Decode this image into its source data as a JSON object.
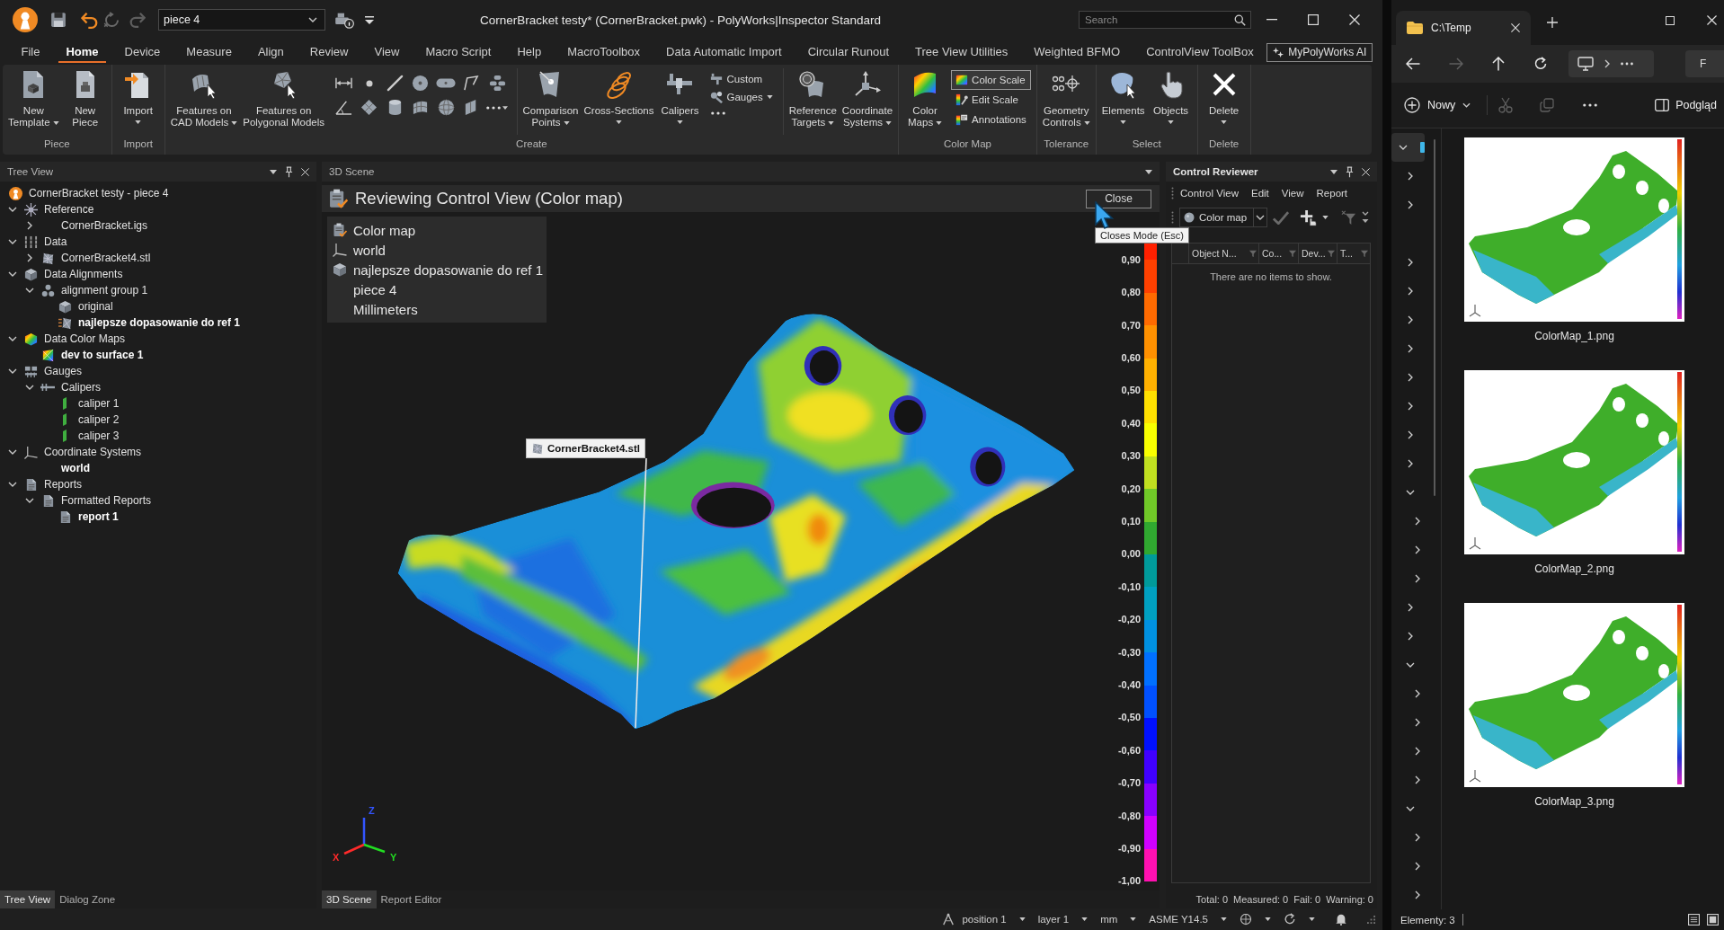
{
  "window": {
    "title": "CornerBracket testy* (CornerBracket.pwk) - PolyWorks|Inspector Standard",
    "piece": "piece 4",
    "search_placeholder": "Search"
  },
  "menu_tabs": [
    {
      "label": "File",
      "selected": false
    },
    {
      "label": "Home",
      "selected": true
    },
    {
      "label": "Device",
      "selected": false
    },
    {
      "label": "Measure",
      "selected": false
    },
    {
      "label": "Align",
      "selected": false
    },
    {
      "label": "Review",
      "selected": false
    },
    {
      "label": "View",
      "selected": false
    },
    {
      "label": "Macro Script",
      "selected": false
    },
    {
      "label": "Help",
      "selected": false
    },
    {
      "label": "MacroToolbox",
      "selected": false
    },
    {
      "label": "Data Automatic Import",
      "selected": false
    },
    {
      "label": "Circular Runout",
      "selected": false
    },
    {
      "label": "Tree View Utilities",
      "selected": false
    },
    {
      "label": "Weighted BFMO",
      "selected": false
    },
    {
      "label": "ControlView ToolBox",
      "selected": false
    }
  ],
  "ai_button": "MyPolyWorks AI",
  "ribbon": [
    {
      "label": "Piece",
      "items": [
        {
          "kind": "large",
          "label": "New\nTemplate",
          "dropdown": true
        },
        {
          "kind": "large",
          "label": "New\nPiece",
          "dropdown": false
        }
      ]
    },
    {
      "label": "Import",
      "items": [
        {
          "kind": "large",
          "label": "Import",
          "dropdown": true
        }
      ]
    },
    {
      "label": "Create",
      "items": [
        {
          "kind": "large",
          "label": "Features on\nCAD Models",
          "dropdown": true
        },
        {
          "kind": "large",
          "label": "Features on\nPolygonal Models",
          "dropdown": false
        },
        {
          "kind": "tools"
        },
        {
          "kind": "separator"
        },
        {
          "kind": "large",
          "label": "Comparison\nPoints",
          "dropdown": true
        },
        {
          "kind": "large",
          "label": "Cross-Sections",
          "dropdown": true
        },
        {
          "kind": "large",
          "label": "Calipers",
          "dropdown": true
        },
        {
          "kind": "stack",
          "items": [
            {
              "kind": "button",
              "label": "Custom",
              "dropdown": false,
              "on": false
            },
            {
              "kind": "button",
              "label": "Gauges",
              "dropdown": true,
              "on": false
            },
            {
              "kind": "more"
            }
          ]
        },
        {
          "kind": "separator"
        },
        {
          "kind": "large",
          "label": "Reference\nTargets",
          "dropdown": true
        },
        {
          "kind": "large",
          "label": "Coordinate\nSystems",
          "dropdown": true
        }
      ]
    },
    {
      "label": "Color Map",
      "items": [
        {
          "kind": "large",
          "label": "Color\nMaps",
          "dropdown": true
        },
        {
          "kind": "stack",
          "items": [
            {
              "kind": "button",
              "label": "Color Scale",
              "dropdown": false,
              "on": true
            },
            {
              "kind": "button",
              "label": "Edit Scale",
              "dropdown": false,
              "on": false
            },
            {
              "kind": "button",
              "label": "Annotations",
              "dropdown": false,
              "on": false
            }
          ]
        }
      ]
    },
    {
      "label": "Tolerance",
      "items": [
        {
          "kind": "large",
          "label": "Geometry\nControls",
          "dropdown": true
        }
      ]
    },
    {
      "label": "Select",
      "items": [
        {
          "kind": "large",
          "label": "Elements",
          "dropdown": true
        },
        {
          "kind": "large",
          "label": "Objects",
          "dropdown": true
        }
      ]
    },
    {
      "label": "Delete",
      "items": [
        {
          "kind": "large",
          "label": "Delete",
          "dropdown": true
        }
      ]
    }
  ],
  "tree_view": {
    "title": "Tree View",
    "items": [
      {
        "label": "CornerBracket testy - piece 4",
        "kind": "project",
        "active": false,
        "children": [
          {
            "label": "Reference",
            "kind": "reference",
            "active": false,
            "expanded": true,
            "children": [
              {
                "label": "CornerBracket.igs",
                "kind": "plain",
                "active": false,
                "expanded": false
              }
            ]
          },
          {
            "label": "Data",
            "kind": "data",
            "active": false,
            "expanded": true,
            "children": [
              {
                "label": "CornerBracket4.stl",
                "kind": "mesh",
                "active": false,
                "expanded": false
              }
            ]
          },
          {
            "label": "Data Alignments",
            "kind": "alignments",
            "active": false,
            "expanded": true,
            "children": [
              {
                "label": "alignment group 1",
                "kind": "alignment-group",
                "active": false,
                "expanded": true,
                "children": [
                  {
                    "label": "original",
                    "kind": "alignment",
                    "active": false
                  },
                  {
                    "label": "najlepsze dopasowanie do ref 1",
                    "kind": "best-fit",
                    "active": true
                  }
                ]
              }
            ]
          },
          {
            "label": "Data Color Maps",
            "kind": "color-maps",
            "active": false,
            "expanded": true,
            "children": [
              {
                "label": "dev to surface 1",
                "kind": "color-map",
                "active": true
              }
            ]
          },
          {
            "label": "Gauges",
            "kind": "gauges",
            "active": false,
            "expanded": true,
            "children": [
              {
                "label": "Calipers",
                "kind": "calipers",
                "active": false,
                "expanded": true,
                "children": [
                  {
                    "label": "caliper 1",
                    "kind": "caliper",
                    "active": false
                  },
                  {
                    "label": "caliper 2",
                    "kind": "caliper",
                    "active": false
                  },
                  {
                    "label": "caliper 3",
                    "kind": "caliper",
                    "active": false
                  }
                ]
              }
            ]
          },
          {
            "label": "Coordinate Systems",
            "kind": "coordinate-systems",
            "active": false,
            "expanded": true,
            "children": [
              {
                "label": "world",
                "kind": "plain",
                "active": true
              }
            ]
          },
          {
            "label": "Reports",
            "kind": "reports",
            "active": false,
            "expanded": true,
            "children": [
              {
                "label": "Formatted Reports",
                "kind": "report-folder",
                "active": false,
                "expanded": true,
                "children": [
                  {
                    "label": "report 1",
                    "kind": "report",
                    "active": true
                  }
                ]
              }
            ]
          }
        ]
      }
    ]
  },
  "left_tabs": [
    {
      "label": "Tree View",
      "selected": true
    },
    {
      "label": "Dialog Zone",
      "selected": false
    }
  ],
  "scene": {
    "title": "3D Scene",
    "mode_title": "Reviewing Control View (Color map)",
    "close_button": "Close",
    "tooltip": "Closes Mode (Esc)",
    "info": [
      {
        "kind": "color-map",
        "text": "Color map"
      },
      {
        "kind": "coordinate-system",
        "text": "world"
      },
      {
        "kind": "alignment",
        "text": "najlepsze dopasowanie do ref 1"
      },
      {
        "kind": "plain",
        "text": "piece 4"
      },
      {
        "kind": "plain",
        "text": "Millimeters"
      }
    ],
    "object_label": "CornerBracket4.stl",
    "scale_labels": [
      "0,90",
      "0,80",
      "0,70",
      "0,60",
      "0,50",
      "0,40",
      "0,30",
      "0,20",
      "0,10",
      "0,00",
      "-0,10",
      "-0,20",
      "-0,30",
      "-0,40",
      "-0,50",
      "-0,60",
      "-0,70",
      "-0,80",
      "-0,90",
      "-1,00"
    ],
    "axes": [
      {
        "label": "X",
        "color": "#ff2a2a"
      },
      {
        "label": "Y",
        "color": "#22dd22"
      },
      {
        "label": "Z",
        "color": "#3355ff"
      }
    ]
  },
  "scene_tabs": [
    {
      "label": "3D Scene",
      "selected": true
    },
    {
      "label": "Report Editor",
      "selected": false
    }
  ],
  "control_reviewer": {
    "title": "Control Reviewer",
    "menu": [
      "Control View",
      "Edit",
      "View",
      "Report"
    ],
    "combo": "Color map",
    "columns": [
      "Object N...",
      "Co...",
      "Dev...",
      "T..."
    ],
    "empty_message": "There are no items to show.",
    "summary": [
      "Total: 0",
      "Measured: 0",
      "Fail: 0",
      "Warning: 0"
    ]
  },
  "status_bar": [
    {
      "kind": "position",
      "label": "position 1"
    },
    {
      "kind": "layer",
      "label": "layer 1"
    },
    {
      "kind": "units",
      "label": "mm"
    },
    {
      "kind": "standard",
      "label": "ASME Y14.5"
    }
  ],
  "explorer": {
    "tab": "C:\\Temp",
    "nav_buttons": [
      {
        "kind": "back",
        "disabled": false
      },
      {
        "kind": "forward",
        "disabled": true
      },
      {
        "kind": "up",
        "disabled": false
      },
      {
        "kind": "refresh",
        "disabled": false
      }
    ],
    "search_partial": "F",
    "new_button": "Nowy",
    "edit_buttons": [
      {
        "kind": "cut",
        "disabled": true
      },
      {
        "kind": "copy",
        "disabled": true
      }
    ],
    "preview_button": "Podgląd",
    "nav_tree": [
      {
        "kind": "node",
        "expanded": true,
        "selected": true,
        "children": [
          {
            "kind": "node",
            "expanded": false,
            "selected": false
          },
          {
            "kind": "node",
            "expanded": false,
            "selected": false
          },
          {
            "kind": "blank"
          },
          {
            "kind": "node",
            "expanded": false,
            "selected": false
          },
          {
            "kind": "node",
            "expanded": false,
            "selected": false
          },
          {
            "kind": "node",
            "expanded": false,
            "selected": false
          },
          {
            "kind": "node",
            "expanded": false,
            "selected": false
          },
          {
            "kind": "node",
            "expanded": false,
            "selected": false
          },
          {
            "kind": "node",
            "expanded": false,
            "selected": false
          },
          {
            "kind": "node",
            "expanded": false,
            "selected": false
          },
          {
            "kind": "node",
            "expanded": false,
            "selected": false
          },
          {
            "kind": "node",
            "expanded": true,
            "selected": false,
            "children": [
              {
                "kind": "node",
                "expanded": false,
                "selected": false
              },
              {
                "kind": "node",
                "expanded": false,
                "selected": false
              },
              {
                "kind": "node",
                "expanded": false,
                "selected": false
              }
            ]
          },
          {
            "kind": "node",
            "expanded": false,
            "selected": false
          },
          {
            "kind": "node",
            "expanded": false,
            "selected": false
          },
          {
            "kind": "node",
            "expanded": true,
            "selected": false,
            "children": [
              {
                "kind": "node",
                "expanded": false,
                "selected": false
              },
              {
                "kind": "node",
                "expanded": false,
                "selected": false
              },
              {
                "kind": "node",
                "expanded": false,
                "selected": false
              },
              {
                "kind": "node",
                "expanded": false,
                "selected": false
              }
            ]
          },
          {
            "kind": "node",
            "expanded": true,
            "selected": false,
            "children": [
              {
                "kind": "node",
                "expanded": false,
                "selected": false
              },
              {
                "kind": "node",
                "expanded": false,
                "selected": false
              },
              {
                "kind": "node",
                "expanded": false,
                "selected": false
              }
            ]
          }
        ]
      }
    ],
    "files": [
      {
        "name": "ColorMap_1.png"
      },
      {
        "name": "ColorMap_2.png"
      },
      {
        "name": "ColorMap_3.png"
      }
    ],
    "status": "Elementy: 3"
  }
}
